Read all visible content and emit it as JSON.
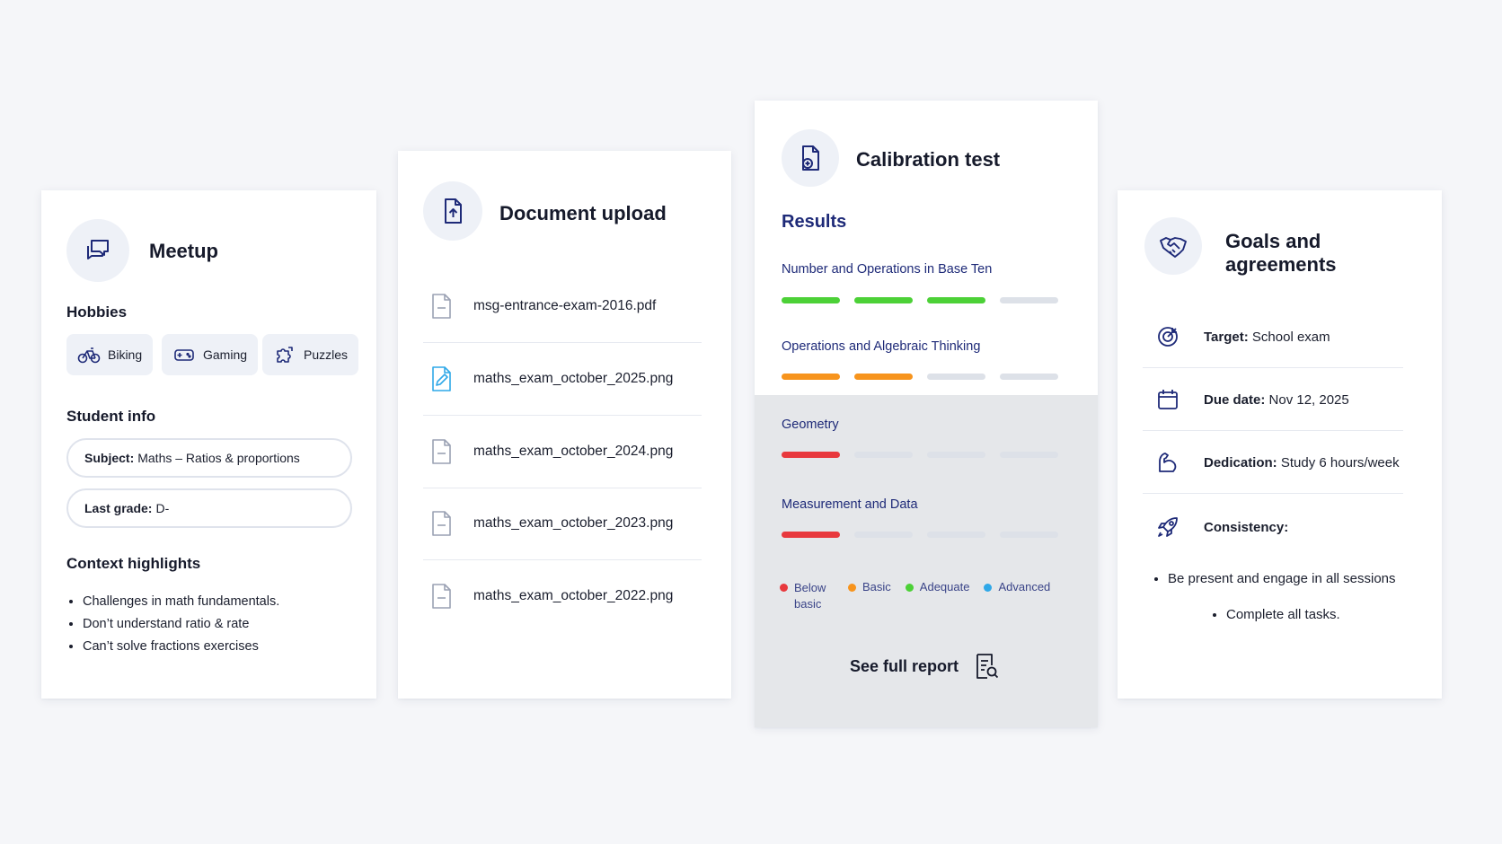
{
  "meetup": {
    "title": "Meetup",
    "hobbies_title": "Hobbies",
    "hobbies": [
      {
        "label": "Biking",
        "icon": "bike-icon"
      },
      {
        "label": "Gaming",
        "icon": "gamepad-icon"
      },
      {
        "label": "Puzzles",
        "icon": "puzzle-icon"
      }
    ],
    "student_info_title": "Student info",
    "subject_key": "Subject:",
    "subject_value": "Maths – Ratios & proportions",
    "grade_key": "Last grade:",
    "grade_value": "D-",
    "context_title": "Context highlights",
    "context": [
      "Challenges in math fundamentals.",
      "Don’t understand ratio & rate",
      "Can’t solve fractions exercises"
    ]
  },
  "docs": {
    "title": "Document upload",
    "files": [
      "msg-entrance-exam-2016.pdf",
      "maths_exam_october_2025.png",
      "maths_exam_october_2024.png",
      "maths_exam_october_2023.png",
      "maths_exam_october_2022.png"
    ]
  },
  "calibration": {
    "title": "Calibration test",
    "results_title": "Results",
    "topics": [
      {
        "label": "Number and Operations in Base Ten",
        "level": 3,
        "color": "#4cd137"
      },
      {
        "label": "Operations and Algebraic Thinking",
        "level": 2,
        "color": "#f7941d"
      },
      {
        "label": "Geometry",
        "level": 1,
        "color": "#e8383d"
      },
      {
        "label": "Measurement and Data",
        "level": 1,
        "color": "#e8383d"
      }
    ],
    "empty_color": "#dde1e8",
    "legend": [
      {
        "label": "Below basic",
        "color": "#e8383d"
      },
      {
        "label": "Basic",
        "color": "#f7941d"
      },
      {
        "label": "Adequate",
        "color": "#4cd137"
      },
      {
        "label": "Advanced",
        "color": "#2fa8e8"
      }
    ],
    "report_label": "See full report"
  },
  "goals": {
    "title_line1": "Goals and",
    "title_line2": "agreements",
    "target_key": "Target:",
    "target_value": "School exam",
    "due_key": "Due date:",
    "due_value": "Nov 12, 2025",
    "dedication_key": "Dedication:",
    "dedication_value": "Study 6 hours/week",
    "consistency_key": "Consistency:",
    "consistency_items": [
      "Be present and engage in all sessions",
      "Complete all tasks."
    ]
  },
  "colors": {
    "accent": "#1e2a78",
    "icon_bg": "#eef1f7"
  }
}
